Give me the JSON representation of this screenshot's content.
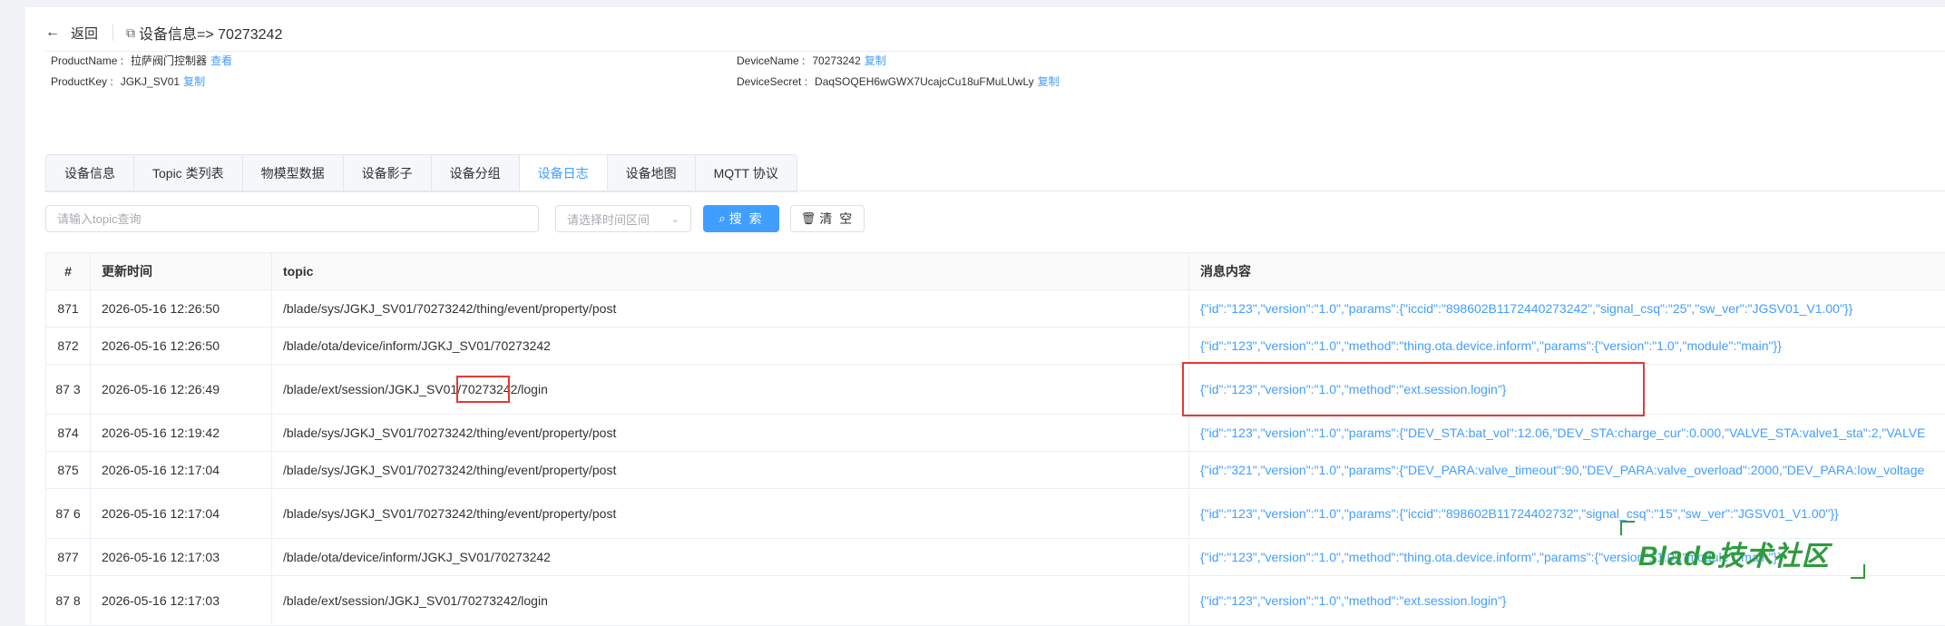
{
  "header": {
    "back_label": "返回",
    "title": "设备信息=> 70273242"
  },
  "info": {
    "product_name_key": "ProductName :",
    "product_name_value": "拉萨阀门控制器",
    "product_name_link": "查看",
    "product_key_key": "ProductKey :",
    "product_key_value": "JGKJ_SV01",
    "product_key_link": "复制",
    "device_name_key": "DeviceName :",
    "device_name_value": "70273242",
    "device_name_link": "复制",
    "device_secret_key": "DeviceSecret :",
    "device_secret_value": "DaqSOQEH6wGWX7UcajcCu18uFMuLUwLy",
    "device_secret_link": "复制"
  },
  "tabs": [
    {
      "label": "设备信息"
    },
    {
      "label": "Topic 类列表"
    },
    {
      "label": "物模型数据"
    },
    {
      "label": "设备影子"
    },
    {
      "label": "设备分组"
    },
    {
      "label": "设备日志",
      "active": true
    },
    {
      "label": "设备地图"
    },
    {
      "label": "MQTT 协议"
    }
  ],
  "search": {
    "placeholder": "请输入topic查询",
    "date_placeholder": "请选择时间区间",
    "search_label": "搜 索",
    "clear_label": "清 空"
  },
  "table": {
    "headers": [
      "#",
      "更新时间",
      "topic",
      "消息内容"
    ],
    "rows": [
      {
        "idx": "871",
        "time": "2026-05-16 12:26:50",
        "topic": "/blade/sys/JGKJ_SV01/70273242/thing/event/property/post",
        "msg": "{\"id\":\"123\",\"version\":\"1.0\",\"params\":{\"iccid\":\"898602B1172440273242\",\"signal_csq\":\"25\",\"sw_ver\":\"JGSV01_V1.00\"}}"
      },
      {
        "idx": "872",
        "time": "2026-05-16 12:26:50",
        "topic": "/blade/ota/device/inform/JGKJ_SV01/70273242",
        "msg": "{\"id\":\"123\",\"version\":\"1.0\",\"method\":\"thing.ota.device.inform\",\"params\":{\"version\":\"1.0\",\"module\":\"main\"}}"
      },
      {
        "idx": "87 3",
        "time": "2026-05-16 12:26:49",
        "topic": "/blade/ext/session/JGKJ_SV01/70273242/login",
        "msg": "{\"id\":\"123\",\"version\":\"1.0\",\"method\":\"ext.session.login\"}"
      },
      {
        "idx": "874",
        "time": "2026-05-16 12:19:42",
        "topic": "/blade/sys/JGKJ_SV01/70273242/thing/event/property/post",
        "msg": "{\"id\":\"123\",\"version\":\"1.0\",\"params\":{\"DEV_STA:bat_vol\":12.06,\"DEV_STA:charge_cur\":0.000,\"VALVE_STA:valve1_sta\":2,\"VALVE"
      },
      {
        "idx": "875",
        "time": "2026-05-16 12:17:04",
        "topic": "/blade/sys/JGKJ_SV01/70273242/thing/event/property/post",
        "msg": "{\"id\":\"321\",\"version\":\"1.0\",\"params\":{\"DEV_PARA:valve_timeout\":90,\"DEV_PARA:valve_overload\":2000,\"DEV_PARA:low_voltage"
      },
      {
        "idx": "87 6",
        "time": "2026-05-16 12:17:04",
        "topic": "/blade/sys/JGKJ_SV01/70273242/thing/event/property/post",
        "msg": "{\"id\":\"123\",\"version\":\"1.0\",\"params\":{\"iccid\":\"898602B11724402732\",\"signal_csq\":\"15\",\"sw_ver\":\"JGSV01_V1.00\"}}"
      },
      {
        "idx": "877",
        "time": "2026-05-16 12:17:03",
        "topic": "/blade/ota/device/inform/JGKJ_SV01/70273242",
        "msg": "{\"id\":\"123\",\"version\":\"1.0\",\"method\":\"thing.ota.device.inform\",\"params\":{\"version\":\"1.0\",\"module\":\"main\"}}"
      },
      {
        "idx": "87 8",
        "time": "2026-05-16 12:17:03",
        "topic": "/blade/ext/session/JGKJ_SV01/70273242/login",
        "msg": "{\"id\":\"123\",\"version\":\"1.0\",\"method\":\"ext.session.login\"}"
      }
    ]
  },
  "watermark": "Blade技术社区",
  "colors": {
    "accent": "#409eff",
    "highlight": "#e53935",
    "watermark": "#2e9b3e"
  }
}
